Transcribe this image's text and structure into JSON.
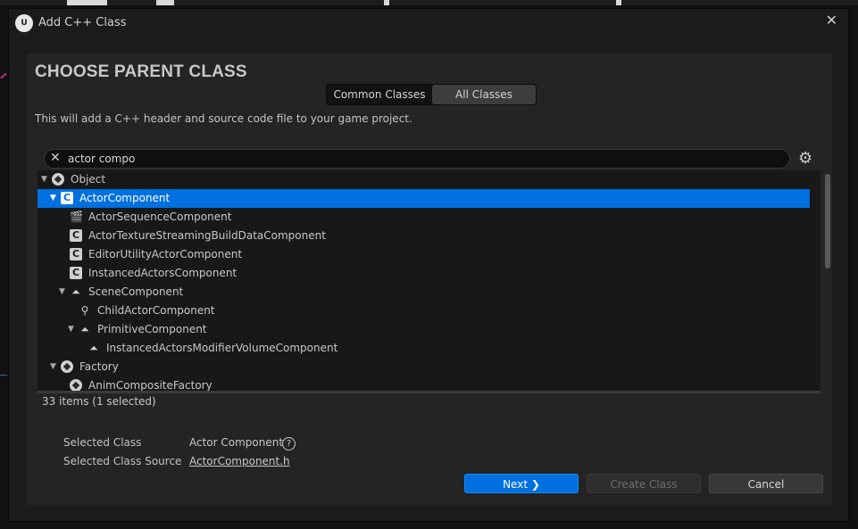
{
  "dialog": {
    "title": "Add C++ Class",
    "logo_text": "U",
    "close_glyph": "✕"
  },
  "header": {
    "heading": "CHOOSE PARENT CLASS"
  },
  "tabs": {
    "common": "Common Classes",
    "all": "All Classes",
    "active": "All Classes"
  },
  "description": "This will add a C++ header and source code file to your game project.",
  "search": {
    "value": "actor compo",
    "clear_glyph": "✕",
    "settings_glyph": "⚙"
  },
  "tree": {
    "items": [
      {
        "label": "Object",
        "icon": "object-icon",
        "depth": 0,
        "arrow": "▼"
      },
      {
        "label": "ActorComponent",
        "icon": "class-icon",
        "depth": 1,
        "arrow": "▼",
        "selected": true
      },
      {
        "label": "ActorSequenceComponent",
        "icon": "sequence-icon",
        "depth": 2
      },
      {
        "label": "ActorTextureStreamingBuildDataComponent",
        "icon": "class-icon",
        "depth": 2
      },
      {
        "label": "EditorUtilityActorComponent",
        "icon": "class-icon",
        "depth": 2
      },
      {
        "label": "InstancedActorsComponent",
        "icon": "class-icon",
        "depth": 2
      },
      {
        "label": "SceneComponent",
        "icon": "scene-component-icon",
        "depth": 2,
        "arrow": "▼"
      },
      {
        "label": "ChildActorComponent",
        "icon": "child-actor-icon",
        "depth": 3
      },
      {
        "label": "PrimitiveComponent",
        "icon": "scene-component-icon",
        "depth": 3,
        "arrow": "▼"
      },
      {
        "label": "InstancedActorsModifierVolumeComponent",
        "icon": "scene-component-icon",
        "depth": 4
      },
      {
        "label": "Factory",
        "icon": "object-icon",
        "depth": 1,
        "arrow": "▼"
      },
      {
        "label": "AnimCompositeFactory",
        "icon": "object-icon",
        "depth": 2
      }
    ]
  },
  "status": {
    "count": "33 items (1 selected)"
  },
  "selection": {
    "class_label": "Selected Class",
    "class_value": "Actor Component",
    "source_label": "Selected Class Source",
    "source_value": "ActorComponent.h",
    "help_glyph": "?"
  },
  "buttons": {
    "next": "Next ❯",
    "create": "Create Class",
    "cancel": "Cancel"
  },
  "colors": {
    "accent": "#0070e0",
    "dialog_bg": "#1b1b1b",
    "panel_bg": "#242424",
    "tree_bg": "#181818"
  }
}
